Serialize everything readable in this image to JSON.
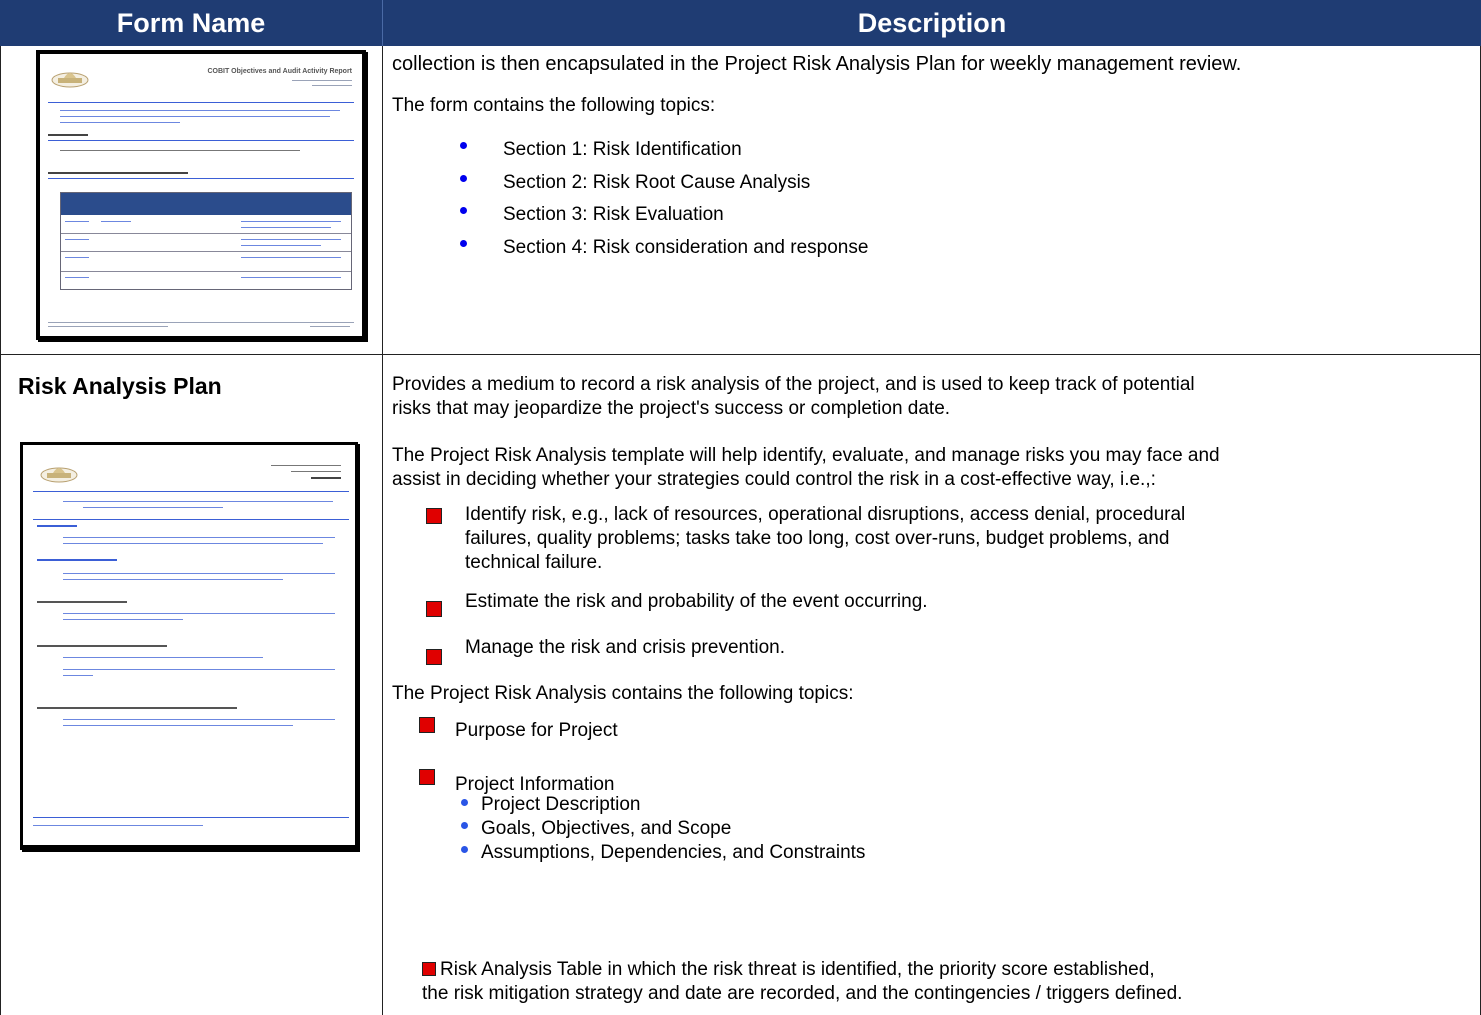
{
  "header": {
    "form_name": "Form Name",
    "description": "Description"
  },
  "row1": {
    "lead": "collection is then encapsulated in the Project Risk Analysis Plan for weekly management review.",
    "topics_intro": "The form contains the following topics:",
    "sections": [
      "Section 1: Risk Identification",
      "Section 2: Risk Root Cause Analysis",
      "Section 3: Risk Evaluation",
      "Section 4: Risk consideration and response"
    ],
    "thumbnail_title": "COBIT Objectives and Audit Activity Report"
  },
  "row2": {
    "form_name": "Risk Analysis Plan",
    "intro_line1": "Provides a medium to record a risk analysis of the project, and is used to keep track of potential",
    "intro_line2": "risks that may jeopardize the project's success or completion date.",
    "template_line1": "The Project Risk Analysis template will help identify, evaluate, and manage risks you may face and",
    "template_line2": "assist in deciding whether your strategies could control the risk in a cost-effective way, i.e.,:",
    "steps": [
      {
        "lines": [
          "Identify risk, e.g., lack of resources, operational disruptions, access denial, procedural",
          "failures, quality problems; tasks take too long, cost over-runs, budget problems, and",
          "technical failure."
        ]
      },
      {
        "lines": [
          "Estimate the risk and probability of the event occurring."
        ]
      },
      {
        "lines": [
          "Manage the risk and crisis prevention."
        ]
      }
    ],
    "topics_intro": "The Project Risk Analysis contains the following topics:",
    "topic_purpose": "Purpose for Project",
    "topic_info": "Project Information",
    "info_subitems": [
      "Project Description",
      "Goals, Objectives, and Scope",
      "Assumptions, Dependencies, and Constraints"
    ],
    "table_line1": "Risk Analysis Table in which the risk threat is identified, the priority score established,",
    "table_line2": "the risk mitigation strategy and date are recorded, and the contingencies / triggers defined."
  },
  "colors": {
    "header_bg": "#1f3c73",
    "red_bullet": "#e00000",
    "blue_bullet": "#0000ee"
  }
}
